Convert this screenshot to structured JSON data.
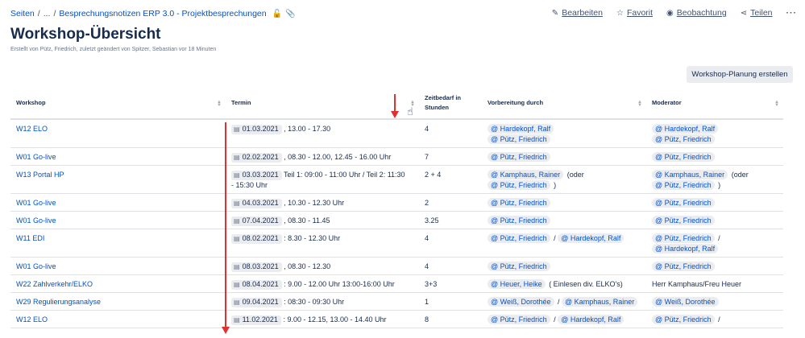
{
  "breadcrumb": {
    "root": "Seiten",
    "ellipsis": "...",
    "page": "Besprechungsnotizen ERP 3.0 - Projektbesprechungen"
  },
  "actions": {
    "edit": "Bearbeiten",
    "favorite": "Favorit",
    "watch": "Beobachtung",
    "share": "Teilen",
    "more": "···"
  },
  "page": {
    "title": "Workshop-Übersicht",
    "byline": "Erstellt von Pütz, Friedrich, zuletzt geändert von Spitzer, Sebastian vor 18 Minuten",
    "create_button": "Workshop-Planung erstellen"
  },
  "table": {
    "headers": {
      "workshop": "Workshop",
      "termin": "Termin",
      "zeitbedarf": "Zeitbedarf in Stunden",
      "vorbereitung": "Vorbereitung durch",
      "moderator": "Moderator"
    },
    "rows": [
      {
        "workshop": "W12 ELO",
        "date": "01.03.2021",
        "time": ", 13.00 - 17.30",
        "hours": "4",
        "prep": [
          "@ Hardekopf, Ralf",
          "@ Pütz, Friedrich"
        ],
        "mod": [
          "@ Hardekopf, Ralf",
          "@ Pütz, Friedrich"
        ]
      },
      {
        "workshop": "W01 Go-live",
        "date": "02.02.2021",
        "time": ", 08.30 - 12.00, 12.45 - 16.00 Uhr",
        "hours": "7",
        "prep": [
          "@ Pütz, Friedrich"
        ],
        "mod": [
          "@ Pütz, Friedrich"
        ]
      },
      {
        "workshop": "W13 Portal HP",
        "date": "03.03.2021",
        "time": "Teil 1:  09:00 - 11:00 Uhr / Teil 2: 11:30",
        "time2": "- 15:30 Uhr",
        "hours": "2 + 4",
        "prep": [
          "@ Kamphaus, Rainer",
          "@ Pütz, Friedrich"
        ],
        "prep_note1": "(oder",
        "prep_note2": ")",
        "mod": [
          "@ Kamphaus, Rainer",
          "@ Pütz, Friedrich"
        ],
        "mod_note1": "(oder",
        "mod_note2": ")"
      },
      {
        "workshop": "W01 Go-live",
        "date": "04.03.2021",
        "time": ", 10.30 - 12.30 Uhr",
        "hours": "2",
        "prep": [
          "@ Pütz, Friedrich"
        ],
        "mod": [
          "@ Pütz, Friedrich"
        ]
      },
      {
        "workshop": "W01 Go-live",
        "date": "07.04.2021",
        "time": ", 08.30 - 11.45",
        "hours": "3.25",
        "prep": [
          "@ Pütz, Friedrich"
        ],
        "mod": [
          "@ Pütz, Friedrich"
        ]
      },
      {
        "workshop": "W11 EDI",
        "date": "08.02.2021",
        "time": ": 8.30 - 12.30 Uhr",
        "hours": "4",
        "prep": [
          "@ Pütz, Friedrich",
          "@ Hardekopf, Ralf"
        ],
        "prep_sep": "/",
        "mod": [
          "@ Pütz, Friedrich",
          "@ Hardekopf, Ralf"
        ],
        "mod_sep": "/"
      },
      {
        "workshop": "W01 Go-live",
        "date": "08.03.2021",
        "time": ", 08.30 - 12.30",
        "hours": "4",
        "prep": [
          "@ Pütz, Friedrich"
        ],
        "mod": [
          "@ Pütz, Friedrich"
        ]
      },
      {
        "workshop": "W22 Zahlverkehr/ELKO",
        "date": "08.04.2021",
        "time": ": 9.00 - 12.00 Uhr 13:00-16:00 Uhr",
        "hours": "3+3",
        "prep": [
          "@ Heuer, Heike"
        ],
        "prep_note1": "( Einlesen div. ELKO's)",
        "mod_text": "Herr Kamphaus/Freu Heuer"
      },
      {
        "workshop": "W29 Regulierungsanalyse",
        "date": "09.04.2021",
        "time": ": 08:30 - 09:30 Uhr",
        "hours": "1",
        "prep": [
          "@ Weiß, Dorothée",
          "@ Kamphaus, Rainer"
        ],
        "prep_sep": "/",
        "mod": [
          "@ Weiß, Dorothée"
        ]
      },
      {
        "workshop": "W12 ELO",
        "date": "11.02.2021",
        "time": ": 9.00 - 12.15, 13.00 - 14.40 Uhr",
        "hours": "8",
        "prep": [
          "@ Pütz, Friedrich",
          "@ Hardekopf, Ralf"
        ],
        "prep_sep": "/",
        "mod": [
          "@ Pütz, Friedrich"
        ],
        "mod_sep": "/"
      }
    ]
  },
  "icons": {
    "calendar": "calendar-icon",
    "edit": "pencil-icon",
    "favorite": "star-icon",
    "watch": "eye-icon",
    "share": "share-icon",
    "sort": "sort-icon"
  },
  "colors": {
    "link": "#0052cc",
    "annotation": "#e03030"
  }
}
